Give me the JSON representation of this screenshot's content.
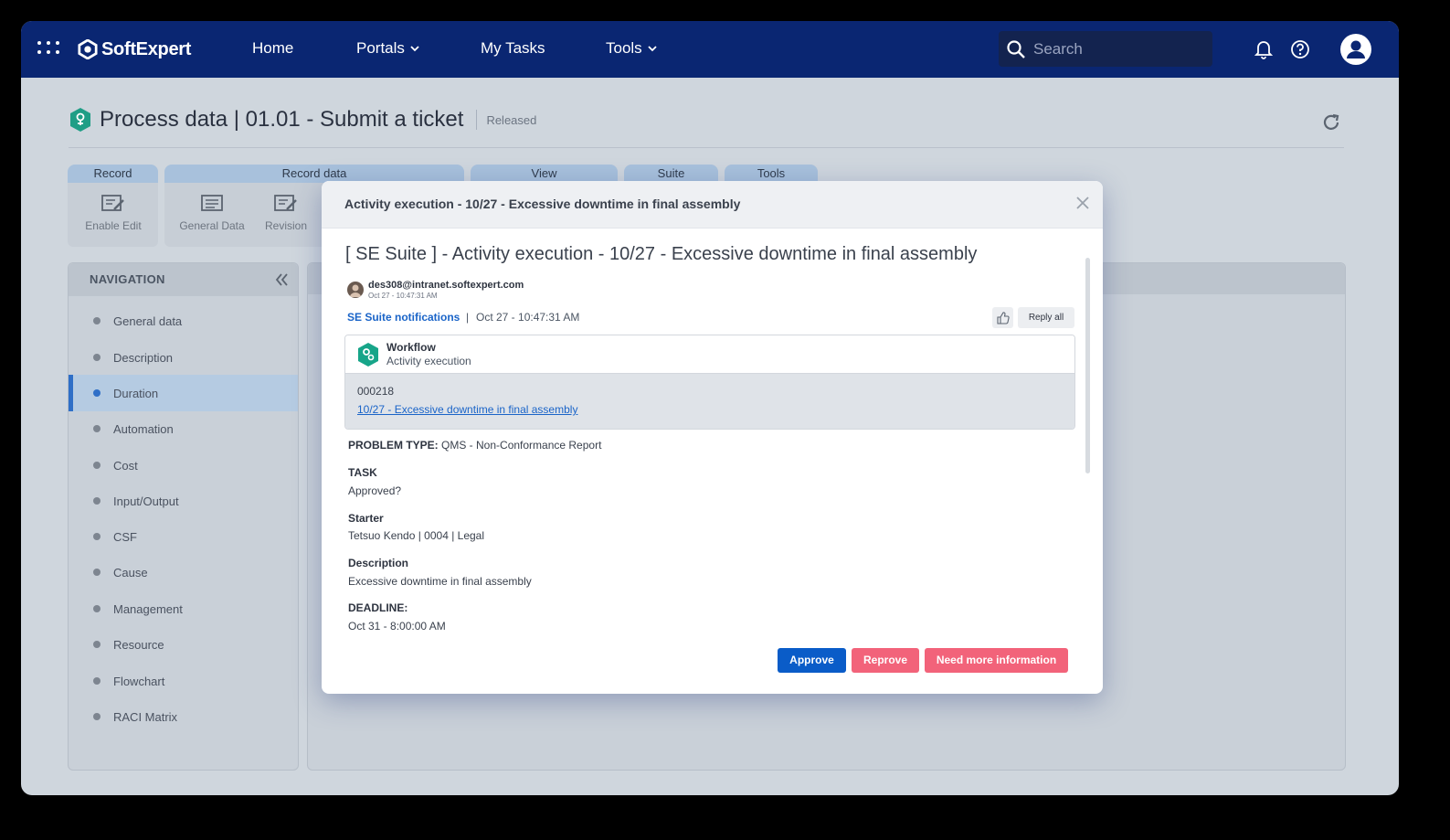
{
  "topbar": {
    "brand": "SoftExpert",
    "nav": [
      {
        "label": "Home"
      },
      {
        "label": "Portals"
      },
      {
        "label": "My Tasks"
      },
      {
        "label": "Tools"
      }
    ],
    "search_placeholder": "Search"
  },
  "header": {
    "title": "Process data |  01.01 - Submit a ticket",
    "status": "Released"
  },
  "ribbon": {
    "groups": [
      {
        "label": "Record",
        "buttons": [
          {
            "label": "Enable Edit"
          }
        ]
      },
      {
        "label": "Record data",
        "buttons": [
          {
            "label": "General Data"
          },
          {
            "label": "Revision"
          }
        ]
      },
      {
        "label": "View"
      },
      {
        "label": "Suite"
      },
      {
        "label": "Tools"
      }
    ]
  },
  "navigation": {
    "title": "NAVIGATION",
    "items": [
      {
        "label": "General data"
      },
      {
        "label": "Description"
      },
      {
        "label": "Duration",
        "active": true
      },
      {
        "label": "Automation"
      },
      {
        "label": "Cost"
      },
      {
        "label": "Input/Output"
      },
      {
        "label": "CSF"
      },
      {
        "label": "Cause"
      },
      {
        "label": "Management"
      },
      {
        "label": "Resource"
      },
      {
        "label": "Flowchart"
      },
      {
        "label": "RACI Matrix"
      }
    ]
  },
  "modal": {
    "title": "Activity execution - 10/27 -  Excessive downtime in final assembly",
    "subject": "[ SE Suite ] - Activity execution - 10/27 - Excessive downtime in final assembly",
    "sender": {
      "email": "des308@intranet.softexpert.com",
      "time": "Oct 27 - 10:47:31 AM"
    },
    "notification": {
      "source": "SE Suite notifications",
      "separator": "|",
      "time": "Oct 27 - 10:47:31 AM"
    },
    "reply_all": "Reply all",
    "workflow": {
      "name": "Workflow",
      "subtitle": "Activity execution",
      "id": "000218",
      "link": "10/27 - Excessive downtime in final assembly"
    },
    "fields": {
      "problem_type_label": "PROBLEM TYPE:",
      "problem_type_value": "QMS - Non-Conformance Report",
      "task_label": "TASK",
      "task_value": "Approved?",
      "starter_label": "Starter",
      "starter_value": "Tetsuo Kendo | 0004 | Legal",
      "description_label": "Description",
      "description_value": "Excessive downtime in final assembly",
      "deadline_label": "DEADLINE:",
      "deadline_value": "Oct 31 - 8:00:00 AM"
    },
    "actions": {
      "approve": "Approve",
      "reprove": "Reprove",
      "more_info": "Need more information"
    }
  },
  "colors": {
    "topbar": "#0a2672",
    "accent": "#1a64c8",
    "approve": "#0a5cc8",
    "reprove": "#f2637a",
    "workflow_icon": "#17a589"
  }
}
